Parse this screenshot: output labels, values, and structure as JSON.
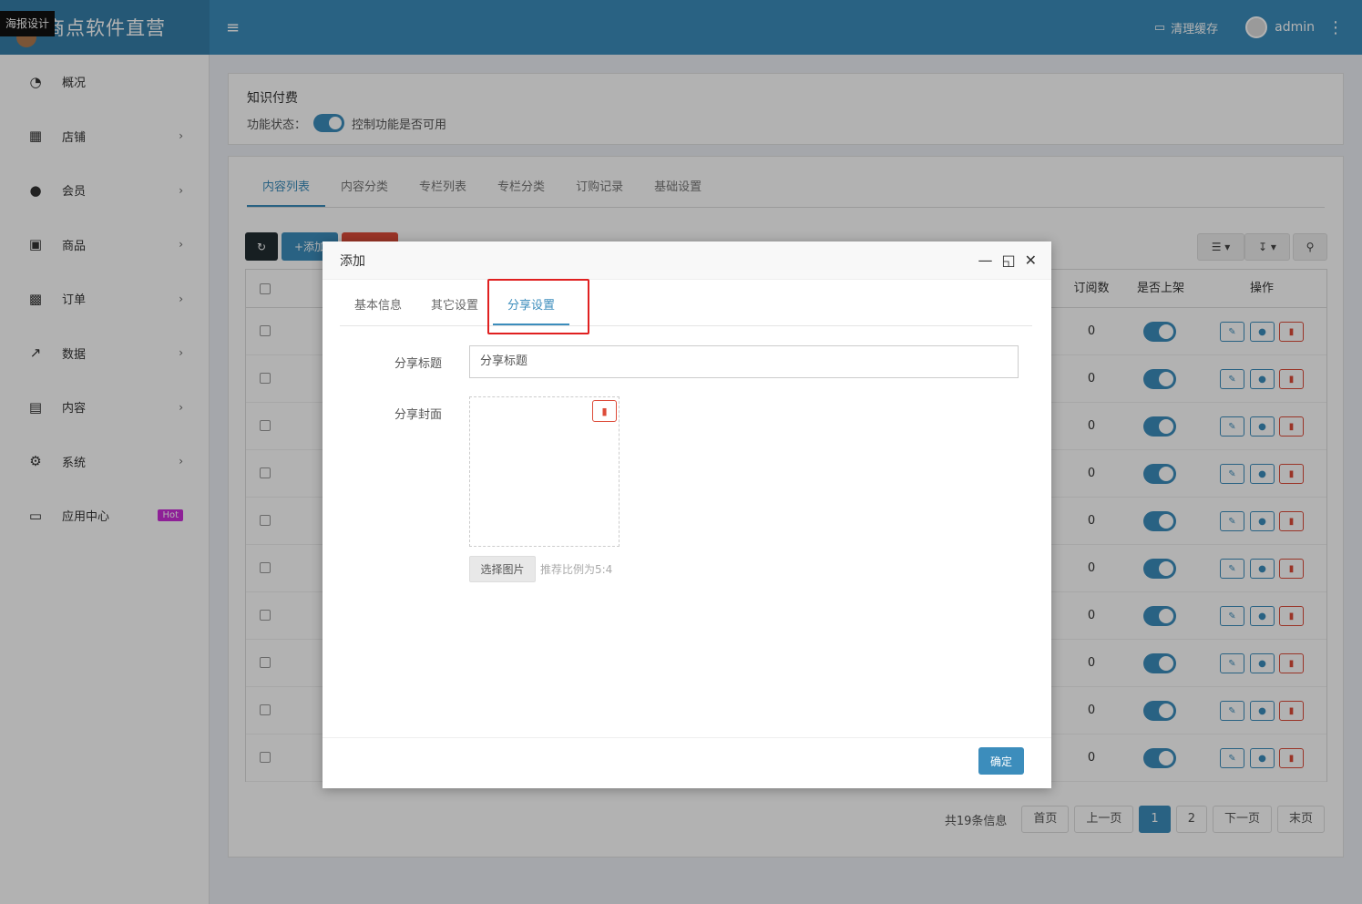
{
  "app": {
    "brand": "商点软件直营",
    "tooltip": "海报设计"
  },
  "header": {
    "clear_cache": "清理缓存",
    "user": "admin",
    "menu_icon": "menu-icon"
  },
  "sidebar": {
    "items": [
      {
        "label": "概况",
        "icon": "dashboard-icon",
        "chevron": false
      },
      {
        "label": "店铺",
        "icon": "grid-icon",
        "chevron": true
      },
      {
        "label": "会员",
        "icon": "users-icon",
        "chevron": true
      },
      {
        "label": "商品",
        "icon": "cart-icon",
        "chevron": true
      },
      {
        "label": "订单",
        "icon": "money-icon",
        "chevron": true
      },
      {
        "label": "数据",
        "icon": "chart-icon",
        "chevron": true
      },
      {
        "label": "内容",
        "icon": "file-icon",
        "chevron": true
      },
      {
        "label": "系统",
        "icon": "gear-icon",
        "chevron": true
      },
      {
        "label": "应用中心",
        "icon": "cube-icon",
        "badge": "Hot"
      }
    ]
  },
  "module": {
    "title": "知识付费",
    "status_label": "功能状态：",
    "status_hint": "控制功能是否可用"
  },
  "tabs": [
    "内容列表",
    "内容分类",
    "专栏列表",
    "专栏分类",
    "订购记录",
    "基础设置"
  ],
  "toolbar": {
    "add": "添加"
  },
  "table": {
    "headers": {
      "subscribers": "订阅数",
      "on_shelf": "是否上架",
      "actions": "操作"
    },
    "rows": [
      {
        "subscribers": "0"
      },
      {
        "subscribers": "0"
      },
      {
        "subscribers": "0"
      },
      {
        "subscribers": "0"
      },
      {
        "subscribers": "0"
      },
      {
        "subscribers": "0"
      },
      {
        "subscribers": "0"
      },
      {
        "subscribers": "0"
      },
      {
        "subscribers": "0"
      },
      {
        "subscribers": "0"
      }
    ]
  },
  "pager": {
    "info": "共19条信息",
    "first": "首页",
    "prev": "上一页",
    "pages": [
      "1",
      "2"
    ],
    "next": "下一页",
    "last": "末页"
  },
  "modal": {
    "title": "添加",
    "tabs": [
      "基本信息",
      "其它设置",
      "分享设置"
    ],
    "share_title_label": "分享标题",
    "share_title_placeholder": "分享标题",
    "share_cover_label": "分享封面",
    "choose_image": "选择图片",
    "hint": "推荐比例为5:4",
    "confirm": "确定"
  },
  "colors": {
    "primary": "#3c8dbc",
    "danger": "#dd4b39",
    "highlight": "#e02020"
  }
}
